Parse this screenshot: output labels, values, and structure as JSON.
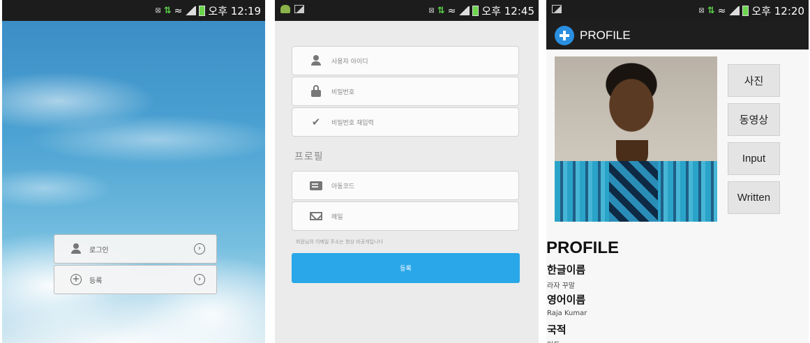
{
  "screen1": {
    "status": {
      "time": "오후 12:19"
    },
    "menu": [
      {
        "label": "로그인"
      },
      {
        "label": "등록"
      }
    ]
  },
  "screen2": {
    "status": {
      "time": "오후 12:45"
    },
    "fields": [
      {
        "placeholder": "사용자 아이디",
        "icon": "user-icon"
      },
      {
        "placeholder": "비밀번호",
        "icon": "lock-icon"
      },
      {
        "placeholder": "비밀번호 재입력",
        "icon": "check-icon"
      }
    ],
    "section_title": "프로필",
    "profile_fields": [
      {
        "placeholder": "아동코드",
        "icon": "card-icon"
      },
      {
        "placeholder": "메일",
        "icon": "mail-icon"
      }
    ],
    "note": "회원님의 이메일 주소는 항상 비공개입니다",
    "submit_label": "등록",
    "accent": "#29a7e8"
  },
  "screen3": {
    "status": {
      "time": "오후 12:20"
    },
    "app_title": "PROFILE",
    "side_buttons": [
      "사진",
      "동영상",
      "Input",
      "Written"
    ],
    "heading": "PROFILE",
    "entries": [
      {
        "label": "한글이름",
        "value": "라자 꾸말"
      },
      {
        "label": "영어이름",
        "value": "Raja Kumar"
      },
      {
        "label": "국적",
        "value": "인도"
      }
    ]
  }
}
